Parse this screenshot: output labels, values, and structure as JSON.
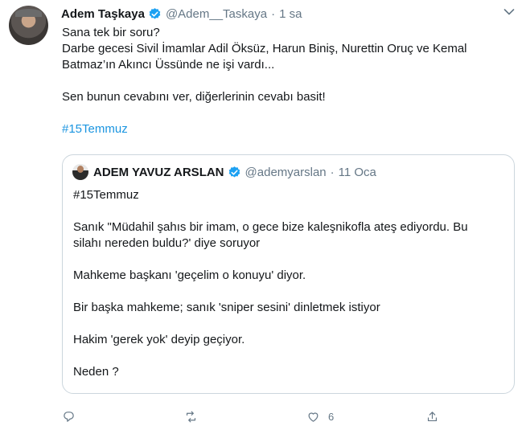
{
  "tweet": {
    "author_name": "Adem Taşkaya",
    "handle": "@Adem__Taskaya",
    "separator": "·",
    "time": "1 sa",
    "lines": {
      "l1": "Sana tek bir soru?",
      "l2": "Darbe gecesi Sivil İmamlar Adil Öksüz, Harun Biniş, Nurettin Oruç ve Kemal",
      "l3": "Batmaz’ın Akıncı Üssünde ne işi vardı...",
      "l4": "Sen bunun cevabını ver, diğerlerinin cevabı basit!"
    },
    "hashtag": "#15Temmuz"
  },
  "quoted": {
    "author_name": "ADEM YAVUZ ARSLAN",
    "handle": "@ademyarslan",
    "separator": "·",
    "time": "11 Oca",
    "lines": {
      "hashtag": "#15Temmuz",
      "l1": "Sanık \"Müdahil şahıs bir imam, o gece bize kaleşnikofla ateş ediyordu. Bu",
      "l2": "silahı nereden buldu?' diye soruyor",
      "l3": "Mahkeme başkanı 'geçelim o konuyu' diyor.",
      "l4": "Bir başka mahkeme; sanık 'sniper sesini' dinletmek istiyor",
      "l5": "Hakim 'gerek yok' deyip geçiyor.",
      "l6": "Neden ?"
    }
  },
  "actions": {
    "like_count": "6"
  },
  "colors": {
    "link": "#1b95e0",
    "secondary_text": "#657786",
    "verified": "#1da1f2",
    "border": "#ccd6dd"
  },
  "icons": [
    "verified-badge-icon",
    "chevron-down-icon",
    "reply-icon",
    "retweet-icon",
    "like-icon",
    "share-icon"
  ]
}
